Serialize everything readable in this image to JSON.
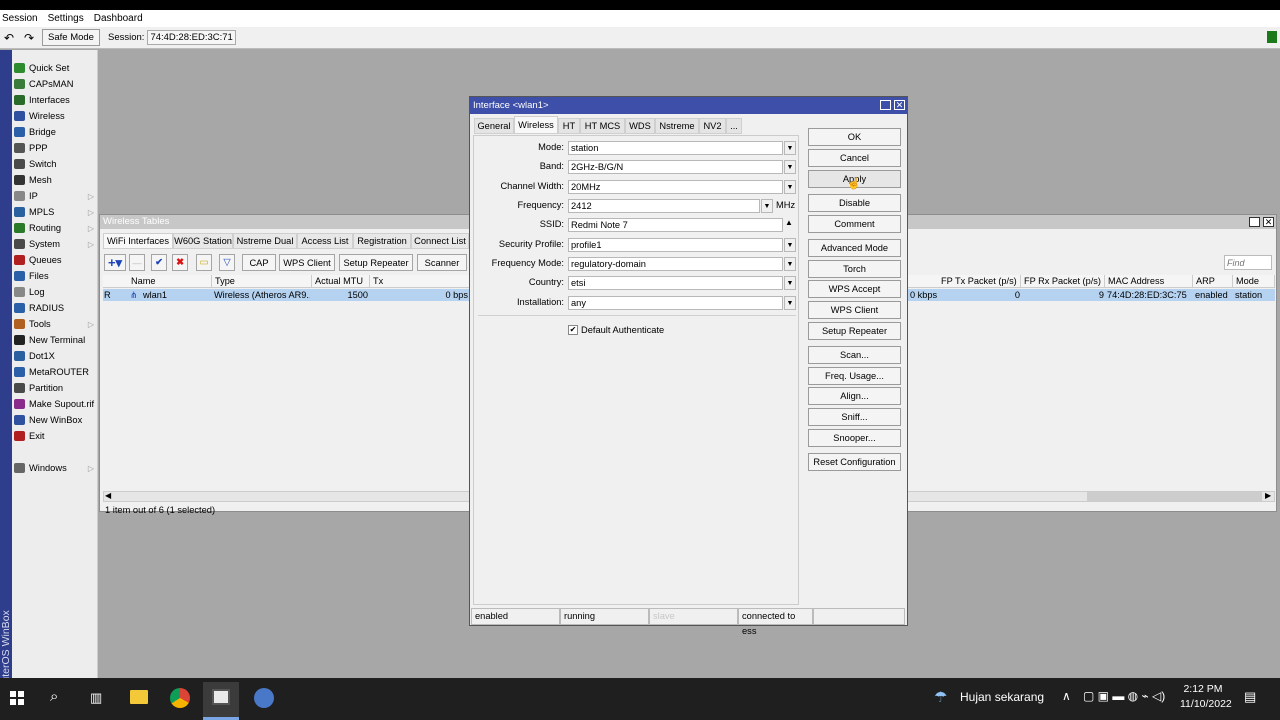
{
  "menu": {
    "session": "Session",
    "settings": "Settings",
    "dashboard": "Dashboard"
  },
  "toolbar": {
    "safe_mode": "Safe Mode",
    "session_label": "Session:",
    "session_value": "74:4D:28:ED:3C:71"
  },
  "sidebar": {
    "vertical_title": "RouterOS WinBox",
    "items": [
      "Quick Set",
      "CAPsMAN",
      "Interfaces",
      "Wireless",
      "Bridge",
      "PPP",
      "Switch",
      "Mesh",
      "IP",
      "MPLS",
      "Routing",
      "System",
      "Queues",
      "Files",
      "Log",
      "RADIUS",
      "Tools",
      "New Terminal",
      "Dot1X",
      "MetaROUTER",
      "Partition",
      "Make Supout.rif",
      "New WinBox",
      "Exit",
      "Windows"
    ]
  },
  "wireless_tables": {
    "title": "Wireless Tables",
    "tabs": [
      "WiFi Interfaces",
      "W60G Station",
      "Nstreme Dual",
      "Access List",
      "Registration",
      "Connect List"
    ],
    "buttons": {
      "cap": "CAP",
      "wps_client": "WPS Client",
      "setup_repeater": "Setup Repeater",
      "scanner": "Scanner"
    },
    "find_placeholder": "Find",
    "columns_left": [
      "Name",
      "Type",
      "Actual MTU",
      "Tx"
    ],
    "columns_right": [
      "FP Tx Packet (p/s)",
      "FP Rx Packet (p/s)",
      "MAC Address",
      "ARP",
      "Mode"
    ],
    "row": {
      "flag": "R",
      "name": "wlan1",
      "type": "Wireless (Atheros AR9...",
      "mtu": "1500",
      "tx": "0 bps",
      "rx_kbps": "0 kbps",
      "fp_tx": "0",
      "fp_rx": "9",
      "mac": "74:4D:28:ED:3C:75",
      "arp": "enabled",
      "mode": "station"
    },
    "status": "1 item out of 6 (1 selected)"
  },
  "dialog": {
    "title": "Interface <wlan1>",
    "tabs": [
      "General",
      "Wireless",
      "HT",
      "HT MCS",
      "WDS",
      "Nstreme",
      "NV2",
      "..."
    ],
    "fields": [
      {
        "label": "Mode:",
        "value": "station"
      },
      {
        "label": "Band:",
        "value": "2GHz-B/G/N"
      },
      {
        "label": "Channel Width:",
        "value": "20MHz"
      },
      {
        "label": "Frequency:",
        "value": "2412",
        "unit": "MHz"
      },
      {
        "label": "SSID:",
        "value": "Redmi Note 7"
      },
      {
        "label": "Security Profile:",
        "value": "profile1"
      },
      {
        "label": "Frequency Mode:",
        "value": "regulatory-domain"
      },
      {
        "label": "Country:",
        "value": "etsi"
      },
      {
        "label": "Installation:",
        "value": "any"
      }
    ],
    "default_authenticate": "Default Authenticate",
    "buttons": [
      "OK",
      "Cancel",
      "Apply",
      "Disable",
      "Comment",
      "Advanced Mode",
      "Torch",
      "WPS Accept",
      "WPS Client",
      "Setup Repeater",
      "Scan...",
      "Freq. Usage...",
      "Align...",
      "Sniff...",
      "Snooper...",
      "Reset Configuration"
    ],
    "status": [
      "enabled",
      "running",
      "slave",
      "connected to ess"
    ]
  },
  "taskbar": {
    "weather": "Hujan sekarang",
    "time": "2:12 PM",
    "date": "11/10/2022"
  },
  "colors": {
    "title_active": "#3d4fa8",
    "selected_row": "#b5d2f0",
    "sidebar_strip": "#2e3d8c"
  }
}
